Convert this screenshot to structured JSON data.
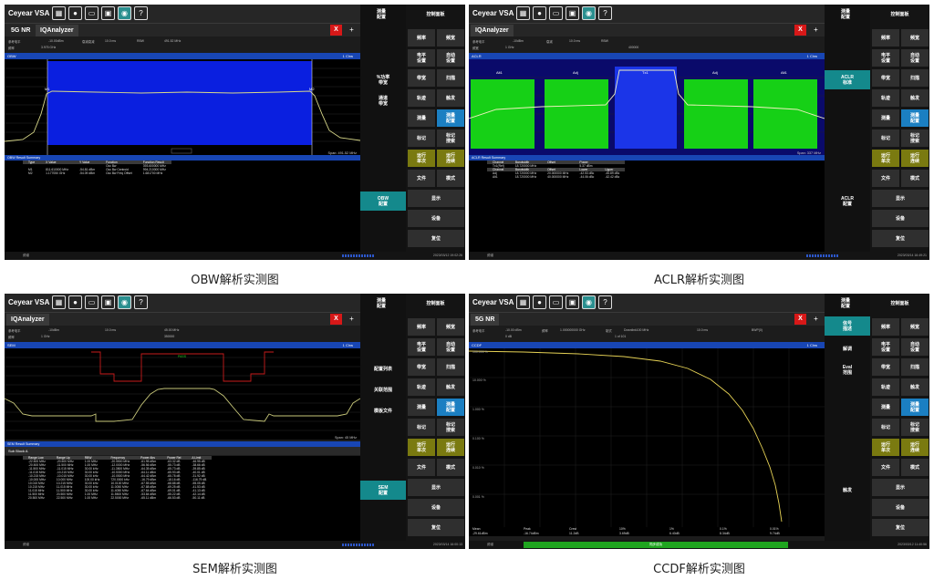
{
  "app": {
    "brand": "Ceyear VSA"
  },
  "captions": [
    "OBW解析实测图",
    "ACLR解析实测图",
    "SEM解析实测图",
    "CCDF解析实测图"
  ],
  "common": {
    "control_panel": "控制面板",
    "meas_config": "测量\n配置",
    "softkeys": [
      "频率",
      "频宽",
      "电平\n设置",
      "自动\n设置",
      "带宽",
      "扫描",
      "轨迹",
      "触发",
      "测量",
      "测量\n配置",
      "标记",
      "标记\n搜索",
      "运行\n单次",
      "运行\n连续",
      "文件",
      "模式",
      "显示",
      "设备",
      "复位"
    ],
    "footer_left": "频谱",
    "trace_tag": "1 Clrw"
  },
  "panels": [
    {
      "tab1": "5G NR",
      "tab2": "IQAnalyzer",
      "trace": "OBW",
      "params": [
        [
          "参考电平",
          "-10.00dBm"
        ],
        [
          "衰减衰减",
          "10.0dB"
        ],
        [
          "扫描时间",
          "10.0 ms"
        ],
        [
          "频率",
          "3.975 GHz"
        ],
        [
          "RBW",
          "1 MHz"
        ],
        [
          "触发",
          "491.52 MHz"
        ]
      ],
      "span": "Span: 491.52 MHz",
      "table_title": "OBW Result Summary",
      "table_header": [
        "Type",
        "X Value",
        "Y Value",
        "Function",
        "Function Result"
      ],
      "table_rows": [
        [
          "",
          "",
          "",
          "Occ Bw",
          "393.600000 MHz"
        ],
        [
          "M1",
          "811.610000 MHz",
          "-54.81 dBm",
          "Occ Bw Centroid",
          "994.210000 MHz"
        ],
        [
          "M2",
          "1.177050 GHz",
          "-54.09 dBm",
          "Occ Bw Freq Offset",
          "1.681700 MHz"
        ]
      ],
      "side": [
        "%功率\n带宽",
        "通道\n带宽",
        "OBW\n配置"
      ],
      "timestamp": "2023/03/12 19:02:26"
    },
    {
      "tab1": "",
      "tab2": "IQAnalyzer",
      "trace": "ACLR",
      "params": [
        [
          "参考电平",
          "-10dBm"
        ],
        [
          "衰减",
          "10.0dB"
        ],
        [
          "扫描时间",
          "10.0 ms"
        ],
        [
          "频宽",
          "1 GHz"
        ],
        [
          "RBW",
          "1 MHz"
        ],
        [
          "触发",
          "400000"
        ]
      ],
      "span": "Span: 337 MHz",
      "table_title": "ACLR Result Summary",
      "table_header": [
        "Channel",
        "Bandwidth",
        "Offset",
        "Power",
        ""
      ],
      "table_rows": [
        [
          "Tx1(Ref)",
          "18.720000 MHz",
          "",
          "5.37 dBm",
          ""
        ],
        [
          "Channel",
          "Bandwidth",
          "Offset",
          "Lower",
          "Upper"
        ],
        [
          "Adj",
          "18.720000 MHz",
          "20.000000 MHz",
          "-42.53 dBc",
          "-45.89 dBc"
        ],
        [
          "Alt1",
          "18.720000 MHz",
          "40.000000 MHz",
          "-44.06 dBc",
          "-42.42 dBc"
        ]
      ],
      "side": [
        "ACLR\n标准",
        "ACLR\n配置"
      ],
      "labels": [
        "Alt1",
        "Adj",
        "Tx1",
        "Adj",
        "Alt1"
      ],
      "timestamp": "2023/03/14 16:49:21"
    },
    {
      "tab1": "",
      "tab2": "IQAnalyzer",
      "trace": "SEM",
      "params": [
        [
          "参考电平",
          "-10dBm"
        ],
        [
          "衰减",
          "10.0 ms"
        ],
        [
          "频宽",
          "45.00 MHz"
        ],
        [
          "频率",
          "1 GHz"
        ],
        [
          "触发",
          "350000"
        ]
      ],
      "span": "Span: 45 MHz",
      "table_title": "SEM Result Summary",
      "sub_block": "Sub Block A",
      "table_header": [
        "Range Low",
        "Range Up",
        "RBW",
        "Frequency",
        "Power Abs",
        "Power Rel",
        "Δ Limit"
      ],
      "table_rows": [
        [
          "-22.500 MHz",
          "-20.500 MHz",
          "1.00 MHz",
          "-20.5500 MHz",
          "-61.95 dBm",
          "-63.32 dB",
          "-46.95 dB"
        ],
        [
          "-20.500 MHz",
          "-11.500 MHz",
          "1.00 MHz",
          "-12.0000 MHz",
          "-56.56 dBm",
          "-55.73 dB",
          "-38.66 dB"
        ],
        [
          "-11.500 MHz",
          "-11.015 MHz",
          "30.00 kHz",
          "-11.3500 MHz",
          "-64.35 dBm",
          "-65.73 dB",
          "-39.85 dB"
        ],
        [
          "-11.015 MHz",
          "-10.215 MHz",
          "30.00 kHz",
          "-10.5300 MHz",
          "-64.11 dBm",
          "-65.93 dB",
          "-40.01 dB"
        ],
        [
          "-10.215 MHz",
          "-10.015 MHz",
          "30.00 kHz",
          "-10.0500 MHz",
          "-64.42 dBm",
          "-65.78 dB",
          "-31.92 dB"
        ],
        [
          "-10.000 MHz",
          "10.000 MHz",
          "100.00 kHz",
          "720.0000 kHz",
          "-16.79 dBm",
          "-18.16 dB",
          "-116.79 dB"
        ],
        [
          "10.015 MHz",
          "10.215 MHz",
          "30.00 kHz",
          "10.0100 MHz",
          "-67.55 dBm",
          "-68.88 dB",
          "-55.05 dB"
        ],
        [
          "10.215 MHz",
          "11.015 MHz",
          "30.00 kHz",
          "11.0050 MHz",
          "-67.88 dBm",
          "-69.25 dB",
          "-41.53 dB"
        ],
        [
          "11.015 MHz",
          "11.500 MHz",
          "30.00 kHz",
          "11.4050 MHz",
          "-67.64 dBm",
          "-69.01 dB",
          "-41.13 dB"
        ],
        [
          "11.500 MHz",
          "20.500 MHz",
          "1.00 MHz",
          "11.5500 MHz",
          "-53.84 dBm",
          "-55.22 dB",
          "-42.14 dB"
        ],
        [
          "20.500 MHz",
          "22.500 MHz",
          "1.00 MHz",
          "22.5000 MHz",
          "-65.11 dBm",
          "-66.53 dB",
          "-50.11 dB"
        ]
      ],
      "side": [
        "配置列表",
        "关联范围",
        "模板文件",
        "SEM\n配置"
      ],
      "timestamp": "2023/03/14 16:00:13"
    },
    {
      "tab1": "5G NR",
      "tab2": "",
      "trace": "CCDF",
      "params": [
        [
          "参考电平",
          "-10.00 dBm"
        ],
        [
          "频率",
          "1.000000000 GHz"
        ],
        [
          "制式",
          "Downlink100 MHz"
        ],
        [
          "扫描时间",
          "10.0 ms"
        ],
        [
          "BWP",
          "BWP(0)"
        ],
        [
          "触发",
          "0 dB"
        ],
        [
          "帧",
          "1 of 101"
        ]
      ],
      "bottom_labels": [
        "Mean",
        "Peak",
        "Crest",
        "10%",
        "1%",
        "0.1%",
        "0.01%"
      ],
      "bottom_values": [
        "-29.61dBm",
        "-16.74dBm",
        "11.2dB",
        "3.69dB",
        "6.40dB",
        "8.34dB",
        "9.74dB"
      ],
      "green_label": "同步成功",
      "side": [
        "信号\n描述",
        "解调",
        "Eval\n范围",
        "触发"
      ],
      "yticks": [
        "100.000 %",
        "10.000 %",
        "1.000 %",
        "0.100 %",
        "0.010 %",
        "0.001 %"
      ],
      "timestamp": "2023/03/12 11:40:56"
    }
  ]
}
